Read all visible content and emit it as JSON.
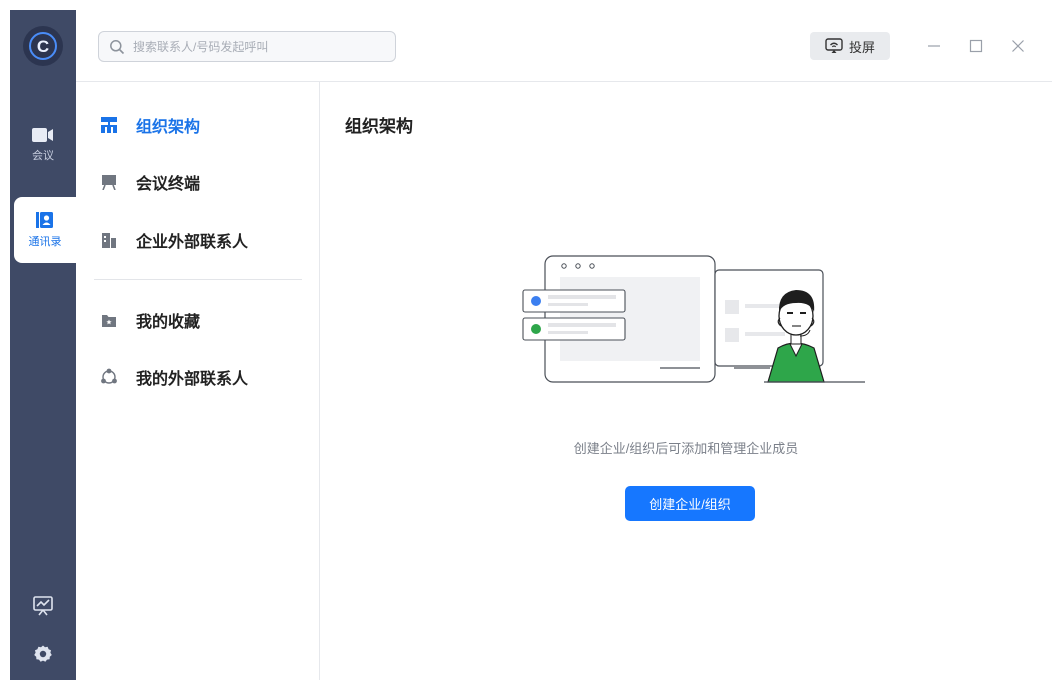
{
  "rail": {
    "items": [
      {
        "label": "会议"
      },
      {
        "label": "通讯录"
      }
    ]
  },
  "search": {
    "placeholder": "搜索联系人/号码发起呼叫"
  },
  "titlebar": {
    "cast_label": "投屏"
  },
  "subnav": {
    "items": [
      {
        "label": "组织架构"
      },
      {
        "label": "会议终端"
      },
      {
        "label": "企业外部联系人"
      },
      {
        "label": "我的收藏"
      },
      {
        "label": "我的外部联系人"
      }
    ]
  },
  "main": {
    "title": "组织架构",
    "empty_text": "创建企业/组织后可添加和管理企业成员",
    "create_button": "创建企业/组织"
  },
  "colors": {
    "rail_bg": "#3f4a66",
    "accent": "#1677ff",
    "active_text": "#1a73e8",
    "avatar_shirt": "#2ea64a"
  }
}
